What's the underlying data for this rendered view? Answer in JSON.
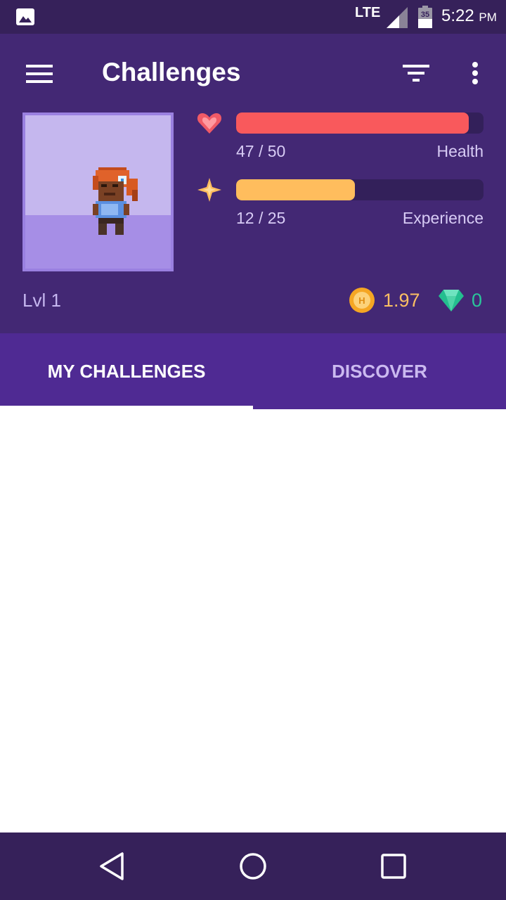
{
  "status_bar": {
    "network": "LTE",
    "battery_level": "35",
    "time": "5:22",
    "ampm": "PM",
    "icons": [
      "image-icon",
      "signal-icon",
      "battery-icon"
    ]
  },
  "header": {
    "title": "Challenges",
    "icons": [
      "menu-icon",
      "filter-icon",
      "more-vert-icon"
    ]
  },
  "stats": {
    "health": {
      "value_text": "47 / 50",
      "label": "Health",
      "current": 47,
      "max": 50,
      "color": "#f9595c",
      "icon": "heart-icon"
    },
    "experience": {
      "value_text": "12 / 25",
      "label": "Experience",
      "current": 12,
      "max": 25,
      "color": "#ffbd5d",
      "icon": "star-icon"
    }
  },
  "currency": {
    "level": "Lvl 1",
    "gold": "1.97",
    "gems": "0",
    "gold_color": "#fbbf63",
    "gem_color": "#2ac59a"
  },
  "tabs": [
    {
      "label": "MY CHALLENGES",
      "active": true
    },
    {
      "label": "DISCOVER",
      "active": false
    }
  ],
  "navbar": {
    "icons": [
      "back-icon",
      "home-icon",
      "recents-icon"
    ]
  },
  "colors": {
    "header": "#432874",
    "tabs": "#4f2a93",
    "status": "#36215a"
  }
}
